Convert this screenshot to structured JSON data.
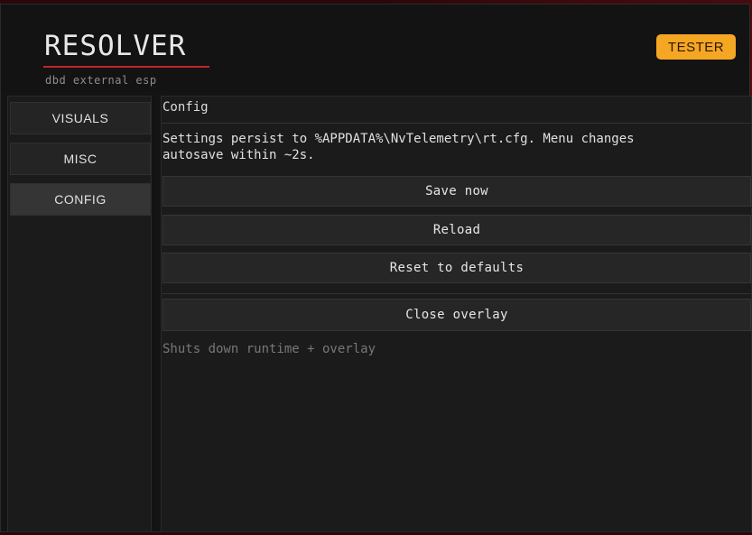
{
  "app": {
    "logo": "RESOLVER",
    "subtitle": "dbd external esp",
    "badge": "TESTER",
    "accent_color": "#c0262b",
    "badge_color": "#f5a623"
  },
  "sidebar": {
    "items": [
      {
        "label": "VISUALS",
        "active": false
      },
      {
        "label": "MISC",
        "active": false
      },
      {
        "label": "CONFIG",
        "active": true
      }
    ]
  },
  "config": {
    "title": "Config",
    "description": "Settings persist to %APPDATA%\\NvTelemetry\\rt.cfg. Menu changes\nautosave within ~2s.",
    "buttons": {
      "save": "Save now",
      "reload": "Reload",
      "reset": "Reset to defaults",
      "close": "Close overlay"
    },
    "close_hint": "Shuts down runtime + overlay"
  }
}
